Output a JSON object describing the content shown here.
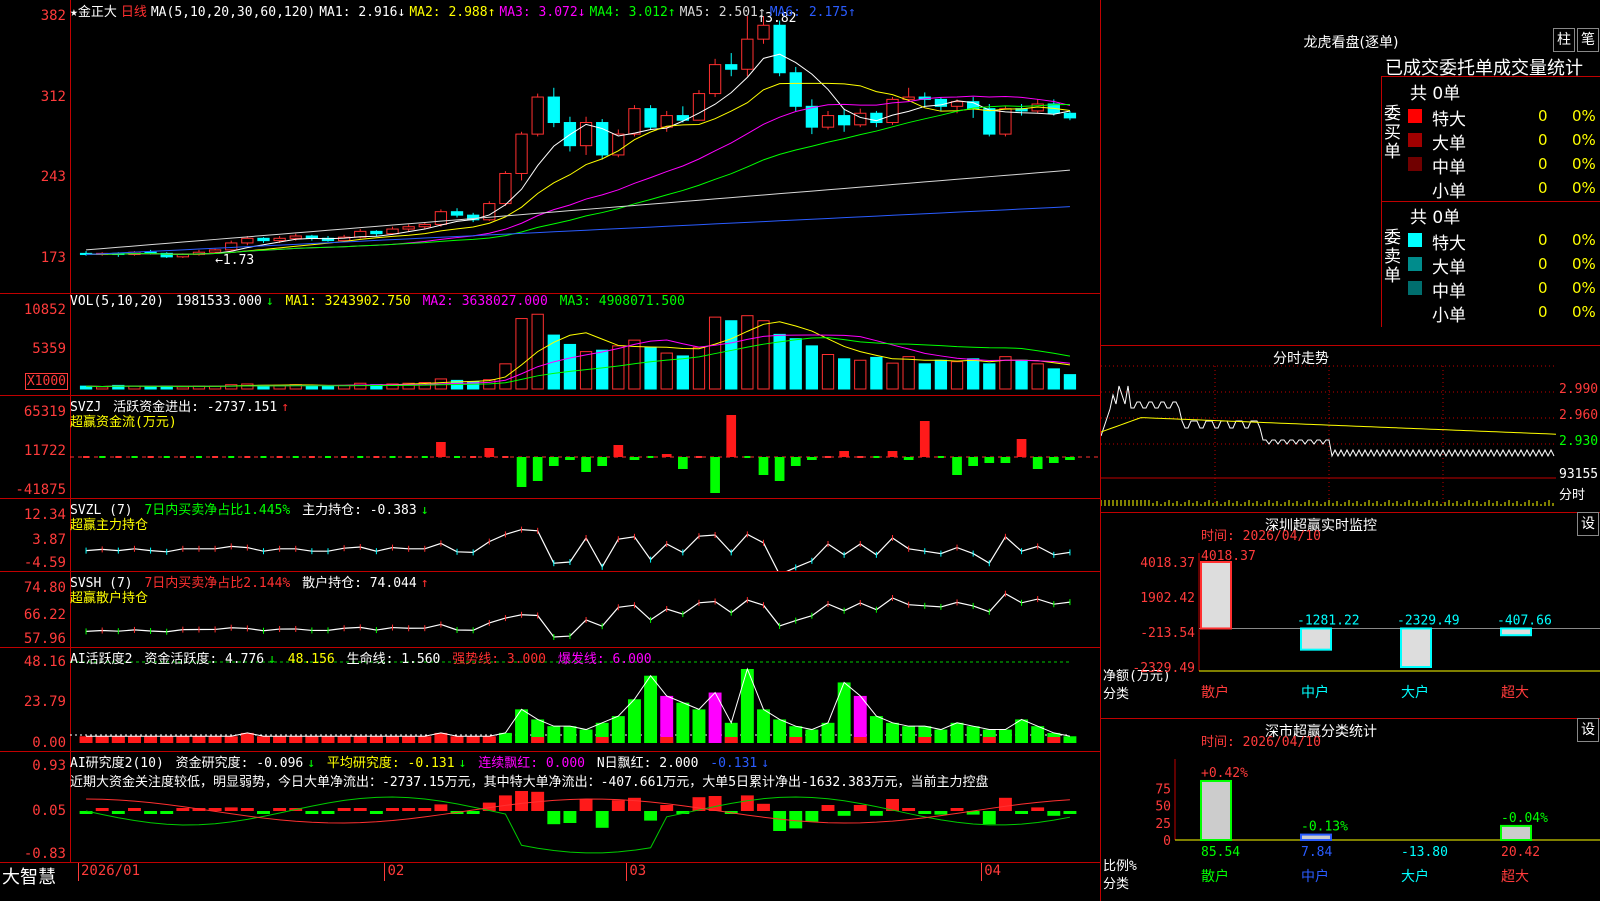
{
  "chart_data": {
    "type": "candlestick",
    "title": "金正大",
    "period": "日线",
    "x_ticks": [
      "2026/01",
      "02",
      "03",
      "04"
    ],
    "candles": [
      {
        "open": 1.77,
        "close": 1.76,
        "high": 1.79,
        "low": 1.75
      },
      {
        "open": 1.76,
        "close": 1.77,
        "high": 1.78,
        "low": 1.75
      },
      {
        "open": 1.77,
        "close": 1.76,
        "high": 1.78,
        "low": 1.74
      },
      {
        "open": 1.76,
        "close": 1.78,
        "high": 1.79,
        "low": 1.75
      },
      {
        "open": 1.78,
        "close": 1.77,
        "high": 1.8,
        "low": 1.76
      },
      {
        "open": 1.77,
        "close": 1.74,
        "high": 1.78,
        "low": 1.73
      },
      {
        "open": 1.74,
        "close": 1.76,
        "high": 1.77,
        "low": 1.73
      },
      {
        "open": 1.76,
        "close": 1.78,
        "high": 1.8,
        "low": 1.75
      },
      {
        "open": 1.78,
        "close": 1.8,
        "high": 1.81,
        "low": 1.77
      },
      {
        "open": 1.8,
        "close": 1.86,
        "high": 1.88,
        "low": 1.79
      },
      {
        "open": 1.86,
        "close": 1.9,
        "high": 1.92,
        "low": 1.84
      },
      {
        "open": 1.9,
        "close": 1.88,
        "high": 1.91,
        "low": 1.86
      },
      {
        "open": 1.88,
        "close": 1.9,
        "high": 1.92,
        "low": 1.86
      },
      {
        "open": 1.9,
        "close": 1.92,
        "high": 1.94,
        "low": 1.88
      },
      {
        "open": 1.92,
        "close": 1.9,
        "high": 1.93,
        "low": 1.88
      },
      {
        "open": 1.9,
        "close": 1.88,
        "high": 1.92,
        "low": 1.87
      },
      {
        "open": 1.88,
        "close": 1.91,
        "high": 1.93,
        "low": 1.87
      },
      {
        "open": 1.91,
        "close": 1.96,
        "high": 1.98,
        "low": 1.9
      },
      {
        "open": 1.96,
        "close": 1.94,
        "high": 1.97,
        "low": 1.92
      },
      {
        "open": 1.94,
        "close": 1.98,
        "high": 2.0,
        "low": 1.93
      },
      {
        "open": 1.98,
        "close": 2.0,
        "high": 2.02,
        "low": 1.96
      },
      {
        "open": 2.0,
        "close": 2.02,
        "high": 2.04,
        "low": 1.98
      },
      {
        "open": 2.02,
        "close": 2.13,
        "high": 2.15,
        "low": 2.0
      },
      {
        "open": 2.13,
        "close": 2.1,
        "high": 2.16,
        "low": 2.08
      },
      {
        "open": 2.1,
        "close": 2.06,
        "high": 2.12,
        "low": 2.04
      },
      {
        "open": 2.06,
        "close": 2.2,
        "high": 2.22,
        "low": 2.05
      },
      {
        "open": 2.2,
        "close": 2.46,
        "high": 2.48,
        "low": 2.18
      },
      {
        "open": 2.46,
        "close": 2.8,
        "high": 2.82,
        "low": 2.4
      },
      {
        "open": 2.8,
        "close": 3.12,
        "high": 3.15,
        "low": 2.78
      },
      {
        "open": 3.12,
        "close": 2.9,
        "high": 3.2,
        "low": 2.86
      },
      {
        "open": 2.9,
        "close": 2.7,
        "high": 2.95,
        "low": 2.65
      },
      {
        "open": 2.7,
        "close": 2.9,
        "high": 2.95,
        "low": 2.62
      },
      {
        "open": 2.9,
        "close": 2.62,
        "high": 2.93,
        "low": 2.58
      },
      {
        "open": 2.62,
        "close": 2.8,
        "high": 2.84,
        "low": 2.6
      },
      {
        "open": 2.8,
        "close": 3.02,
        "high": 3.05,
        "low": 2.78
      },
      {
        "open": 3.02,
        "close": 2.86,
        "high": 3.05,
        "low": 2.84
      },
      {
        "open": 2.86,
        "close": 2.96,
        "high": 3.0,
        "low": 2.82
      },
      {
        "open": 2.96,
        "close": 2.92,
        "high": 3.04,
        "low": 2.9
      },
      {
        "open": 2.92,
        "close": 3.15,
        "high": 3.18,
        "low": 2.92
      },
      {
        "open": 3.15,
        "close": 3.4,
        "high": 3.45,
        "low": 3.12
      },
      {
        "open": 3.4,
        "close": 3.36,
        "high": 3.5,
        "low": 3.3
      },
      {
        "open": 3.36,
        "close": 3.62,
        "high": 3.82,
        "low": 3.3
      },
      {
        "open": 3.62,
        "close": 3.74,
        "high": 3.82,
        "low": 3.58
      },
      {
        "open": 3.74,
        "close": 3.33,
        "high": 3.78,
        "low": 3.3
      },
      {
        "open": 3.33,
        "close": 3.04,
        "high": 3.38,
        "low": 3.0
      },
      {
        "open": 3.04,
        "close": 2.86,
        "high": 3.1,
        "low": 2.8
      },
      {
        "open": 2.86,
        "close": 2.96,
        "high": 3.0,
        "low": 2.84
      },
      {
        "open": 2.96,
        "close": 2.88,
        "high": 3.02,
        "low": 2.82
      },
      {
        "open": 2.88,
        "close": 2.98,
        "high": 3.02,
        "low": 2.86
      },
      {
        "open": 2.98,
        "close": 2.9,
        "high": 3.0,
        "low": 2.86
      },
      {
        "open": 2.9,
        "close": 3.1,
        "high": 3.12,
        "low": 2.88
      },
      {
        "open": 3.1,
        "close": 3.12,
        "high": 3.2,
        "low": 3.08
      },
      {
        "open": 3.12,
        "close": 3.1,
        "high": 3.16,
        "low": 3.04
      },
      {
        "open": 3.1,
        "close": 3.04,
        "high": 3.12,
        "low": 3.0
      },
      {
        "open": 3.04,
        "close": 3.08,
        "high": 3.1,
        "low": 2.98
      },
      {
        "open": 3.08,
        "close": 3.02,
        "high": 3.12,
        "low": 2.94
      },
      {
        "open": 3.02,
        "close": 2.8,
        "high": 3.06,
        "low": 2.78
      },
      {
        "open": 2.8,
        "close": 3.02,
        "high": 3.04,
        "low": 2.78
      },
      {
        "open": 3.02,
        "close": 3.0,
        "high": 3.06,
        "low": 2.96
      },
      {
        "open": 3.0,
        "close": 3.06,
        "high": 3.1,
        "low": 2.98
      },
      {
        "open": 3.06,
        "close": 2.98,
        "high": 3.1,
        "low": 2.96
      },
      {
        "open": 2.98,
        "close": 2.94,
        "high": 3.0,
        "low": 2.92
      }
    ],
    "y_ticks": [
      3.82,
      3.12,
      2.43,
      1.73
    ],
    "y_tick_labels": [
      "382",
      "312",
      "243",
      "173"
    ],
    "annotations": {
      "high": "3.82",
      "low": "1.73"
    },
    "ma_lines": [
      {
        "name": "MA1",
        "label": "MA1: 2.916",
        "arrow": "↓",
        "color": "#ffffff"
      },
      {
        "name": "MA2",
        "label": "MA2: 2.988",
        "arrow": "↑",
        "color": "#ffff00"
      },
      {
        "name": "MA3",
        "label": "MA3: 3.072",
        "arrow": "↓",
        "color": "#ff00ff"
      },
      {
        "name": "MA4",
        "label": "MA4: 3.012",
        "arrow": "↑",
        "color": "#00ff00"
      },
      {
        "name": "MA5",
        "label": "MA5: 2.501",
        "arrow": "↑",
        "color": "#d8d8d8"
      },
      {
        "name": "MA6",
        "label": "MA6: 2.175",
        "arrow": "↑",
        "color": "#2a5cff"
      }
    ]
  },
  "price_header": {
    "title": "★金正大",
    "period": "日线",
    "params": "MA(5,10,20,30,60,120)"
  },
  "vol_header": {
    "label": "VOL(5,10,20)",
    "value": "1981533.000",
    "arrow": "↓",
    "ma1": "MA1: 3243902.750",
    "ma2": "MA2: 3638027.000",
    "ma3": "MA3: 4908071.500"
  },
  "vol_ticks": [
    "10852",
    "5359"
  ],
  "vol_unit": "X1000",
  "vol_values": [
    0.4,
    0.3,
    0.5,
    0.4,
    0.3,
    0.4,
    0.3,
    0.4,
    0.4,
    0.6,
    0.7,
    0.5,
    0.5,
    0.6,
    0.5,
    0.4,
    0.5,
    0.8,
    0.6,
    0.7,
    0.8,
    0.9,
    1.4,
    1.2,
    1.0,
    1.3,
    3.5,
    9.8,
    10.4,
    7.5,
    6.2,
    5.2,
    5.4,
    6.0,
    6.8,
    5.8,
    5.0,
    4.6,
    5.8,
    10.0,
    9.5,
    10.2,
    9.5,
    7.6,
    7.0,
    6.0,
    4.8,
    4.2,
    4.0,
    4.4,
    3.6,
    4.5,
    3.5,
    4.0,
    3.8,
    4.2,
    3.5,
    4.5,
    4.0,
    3.5,
    2.8,
    2.0
  ],
  "svzj_header": {
    "label": "SVZJ",
    "text": "活跃资金进出: -2737.151",
    "arrow": "↑",
    "sub": "超赢资金流(万元)"
  },
  "svzj_ticks": [
    "65319",
    "11722",
    "-41875"
  ],
  "svzj_values": [
    0,
    0,
    0,
    0,
    0,
    0,
    0,
    0,
    0,
    0,
    0,
    0,
    0,
    0,
    0,
    0,
    0,
    0,
    0,
    0,
    0,
    0,
    5,
    0,
    0,
    3,
    0,
    -10,
    -8,
    -3,
    -1,
    -5,
    -3,
    4,
    -1,
    0,
    1,
    -4,
    0,
    -12,
    14,
    0,
    -6,
    -8,
    -3,
    -1,
    0,
    2,
    0,
    0,
    2,
    -1,
    12,
    0,
    -6,
    -3,
    -2,
    -2,
    6,
    -4,
    -2,
    -1
  ],
  "svzl_header": {
    "label": "SVZL (7)",
    "text1": "7日内买卖净占比1.445%",
    "text2": "主力持仓: -0.383",
    "arrow": "↓",
    "sub": "超赢主力持仓"
  },
  "svzl_ticks": [
    "12.34",
    "3.87",
    "-4.59"
  ],
  "svsh_header": {
    "label": "SVSH (7)",
    "text1": "7日内买卖净占比2.144%",
    "text2": "散户持仓: 74.044",
    "arrow": "↑",
    "sub": "超赢散户持仓"
  },
  "svsh_ticks": [
    "74.80",
    "66.22",
    "57.96"
  ],
  "ai_header": {
    "label": "AI活跃度2",
    "t1": "资金活跃度: 4.776",
    "a1": "↓",
    "t2": "48.156",
    "t3": "生命线: 1.560",
    "t4": "强势线: 3.000",
    "t5": "爆发线: 6.000"
  },
  "ai_ticks": [
    "48.16",
    "23.79",
    "0.00"
  ],
  "ai_values": [
    2,
    2,
    2,
    2,
    2,
    2,
    2,
    2,
    2,
    2,
    3,
    2,
    2,
    2,
    2,
    2,
    2,
    2,
    2,
    2,
    2,
    2,
    3,
    2,
    2,
    2,
    3,
    10,
    7,
    5,
    5,
    4,
    6,
    8,
    13,
    20,
    14,
    12,
    10,
    15,
    6,
    22,
    10,
    7,
    5,
    4,
    6,
    18,
    14,
    8,
    6,
    5,
    5,
    4,
    6,
    5,
    4,
    4,
    7,
    5,
    3,
    2
  ],
  "research_header": {
    "label": "AI研究度2(10)",
    "t1": "资金研究度: -0.096",
    "a1": "↓",
    "t2": "平均研究度: -0.131",
    "a2": "↓",
    "t3": "连续飘红: 0.000",
    "t4": "N日飘红: 2.000",
    "t5": "-0.131",
    "a5": "↓"
  },
  "research_ticks": [
    "0.93",
    "0.05",
    "-0.83"
  ],
  "research_text": "近期大资金关注度较低，明显弱势，今日大单净流出：-2737.15万元，其中特大单净流出：-407.661万元，大单5日累计净出-1632.383万元，当前主力控盘",
  "logo": "大智慧",
  "dragon": {
    "title": "龙虎看盘(逐单)",
    "btn1": "柱",
    "btn2": "笔",
    "heading": "已成交委托单成交量统计",
    "buy_label": "委买单",
    "sell_label": "委卖单",
    "buy_total": "共 0单",
    "sell_total": "共 0单",
    "rows_buy": [
      {
        "name": "特大",
        "v": "0",
        "p": "0%",
        "color": "#ff0000"
      },
      {
        "name": "大单",
        "v": "0",
        "p": "0%",
        "color": "#a00000"
      },
      {
        "name": "中单",
        "v": "0",
        "p": "0%",
        "color": "#700000"
      },
      {
        "name": "小单",
        "v": "0",
        "p": "0%",
        "color": "#000000"
      }
    ],
    "rows_sell": [
      {
        "name": "特大",
        "v": "0",
        "p": "0%",
        "color": "#00ffff"
      },
      {
        "name": "大单",
        "v": "0",
        "p": "0%",
        "color": "#008c8c"
      },
      {
        "name": "中单",
        "v": "0",
        "p": "0%",
        "color": "#006e6e"
      },
      {
        "name": "小单",
        "v": "0",
        "p": "0%",
        "color": "#000000"
      }
    ]
  },
  "intraday": {
    "title": "分时走势",
    "ticks": [
      "2.990",
      "2.960",
      "2.930"
    ],
    "vol_tick": "93155",
    "foot": "分时"
  },
  "monitor": {
    "title": "深圳超赢实时监控",
    "btn": "设",
    "time": "时间: 2026/04/10",
    "ticks": [
      "4018.37",
      "1902.42",
      "-213.54",
      "-2329.49"
    ],
    "ylab": "净额(万元)",
    "xlab": "分类",
    "cats": [
      "散户",
      "中户",
      "大户",
      "超大"
    ],
    "values": [
      4018.37,
      -1281.22,
      -2329.49,
      -407.66
    ],
    "value_labels": [
      "4018.37",
      "-1281.22",
      "-2329.49",
      "-407.66"
    ]
  },
  "classify": {
    "title": "深市超赢分类统计",
    "btn": "设",
    "time": "时间: 2026/04/10",
    "ticks": [
      "75",
      "50",
      "25",
      "0"
    ],
    "ylab": "比例%",
    "xlab": "分类",
    "cats": [
      "散户",
      "中户",
      "大户",
      "超大"
    ],
    "bars": [
      85.54,
      7.84,
      0,
      20.42
    ],
    "top_labels": [
      "+0.42%",
      "-0.13%",
      "",
      "-0.04%"
    ],
    "bottom_labels": [
      "85.54",
      "7.84",
      "-13.80",
      "20.42"
    ]
  }
}
